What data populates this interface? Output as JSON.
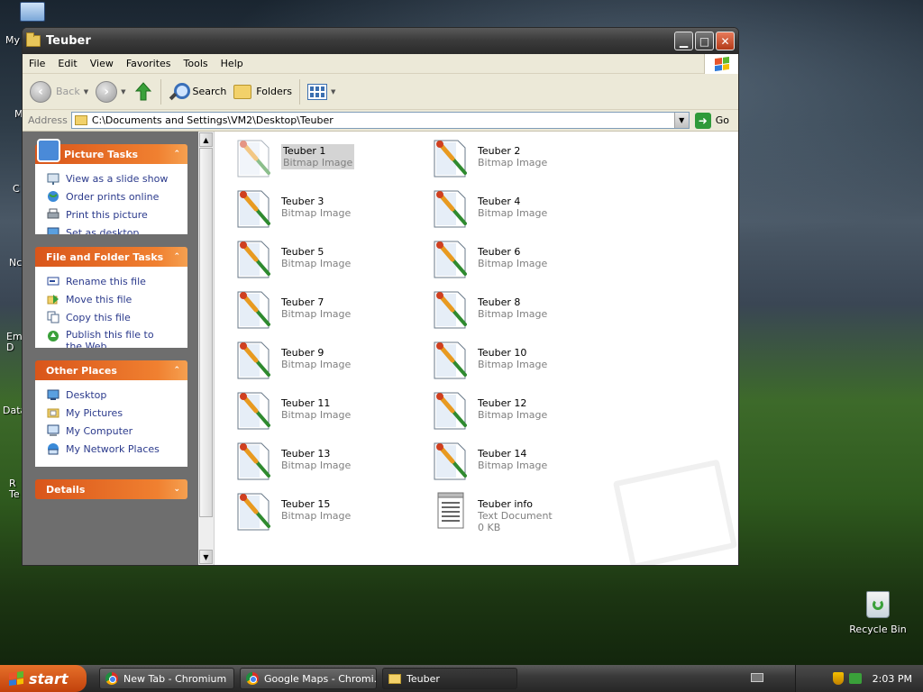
{
  "desktop": {
    "left_peek": [
      "My",
      "M",
      "C",
      "Nc",
      "Em\nD",
      "Data",
      "R\nTe"
    ],
    "recycle_bin": "Recycle Bin"
  },
  "window": {
    "title": "Teuber",
    "menu": [
      "File",
      "Edit",
      "View",
      "Favorites",
      "Tools",
      "Help"
    ],
    "toolbar": {
      "back": "Back",
      "search": "Search",
      "folders": "Folders"
    },
    "address": {
      "label": "Address",
      "value": "C:\\Documents and Settings\\VM2\\Desktop\\Teuber",
      "go": "Go"
    }
  },
  "taskpane": {
    "picture_tasks": {
      "title": "Picture Tasks",
      "items": [
        "View as a slide show",
        "Order prints online",
        "Print this picture",
        "Set as desktop"
      ]
    },
    "file_folder_tasks": {
      "title": "File and Folder Tasks",
      "items": [
        "Rename this file",
        "Move this file",
        "Copy this file",
        "Publish this file to the Web"
      ]
    },
    "other_places": {
      "title": "Other Places",
      "items": [
        "Desktop",
        "My Pictures",
        "My Computer",
        "My Network Places"
      ]
    },
    "details": {
      "title": "Details"
    }
  },
  "files": [
    {
      "name": "Teuber 1",
      "type": "Bitmap Image"
    },
    {
      "name": "Teuber 2",
      "type": "Bitmap Image"
    },
    {
      "name": "Teuber 3",
      "type": "Bitmap Image"
    },
    {
      "name": "Teuber 4",
      "type": "Bitmap Image"
    },
    {
      "name": "Teuber 5",
      "type": "Bitmap Image"
    },
    {
      "name": "Teuber 6",
      "type": "Bitmap Image"
    },
    {
      "name": "Teuber 7",
      "type": "Bitmap Image"
    },
    {
      "name": "Teuber 8",
      "type": "Bitmap Image"
    },
    {
      "name": "Teuber 9",
      "type": "Bitmap Image"
    },
    {
      "name": "Teuber 10",
      "type": "Bitmap Image"
    },
    {
      "name": "Teuber 11",
      "type": "Bitmap Image"
    },
    {
      "name": "Teuber 12",
      "type": "Bitmap Image"
    },
    {
      "name": "Teuber 13",
      "type": "Bitmap Image"
    },
    {
      "name": "Teuber 14",
      "type": "Bitmap Image"
    },
    {
      "name": "Teuber 15",
      "type": "Bitmap Image"
    },
    {
      "name": "Teuber info",
      "type": "Text Document",
      "size": "0 KB"
    }
  ],
  "taskbar": {
    "start": "start",
    "items": [
      "New Tab - Chromium",
      "Google Maps - Chromi...",
      "Teuber"
    ],
    "clock": "2:03 PM"
  },
  "colors": {
    "task_header": "#e8692a",
    "task_link": "#2b3a8c",
    "selection": "#d4d4d4"
  }
}
